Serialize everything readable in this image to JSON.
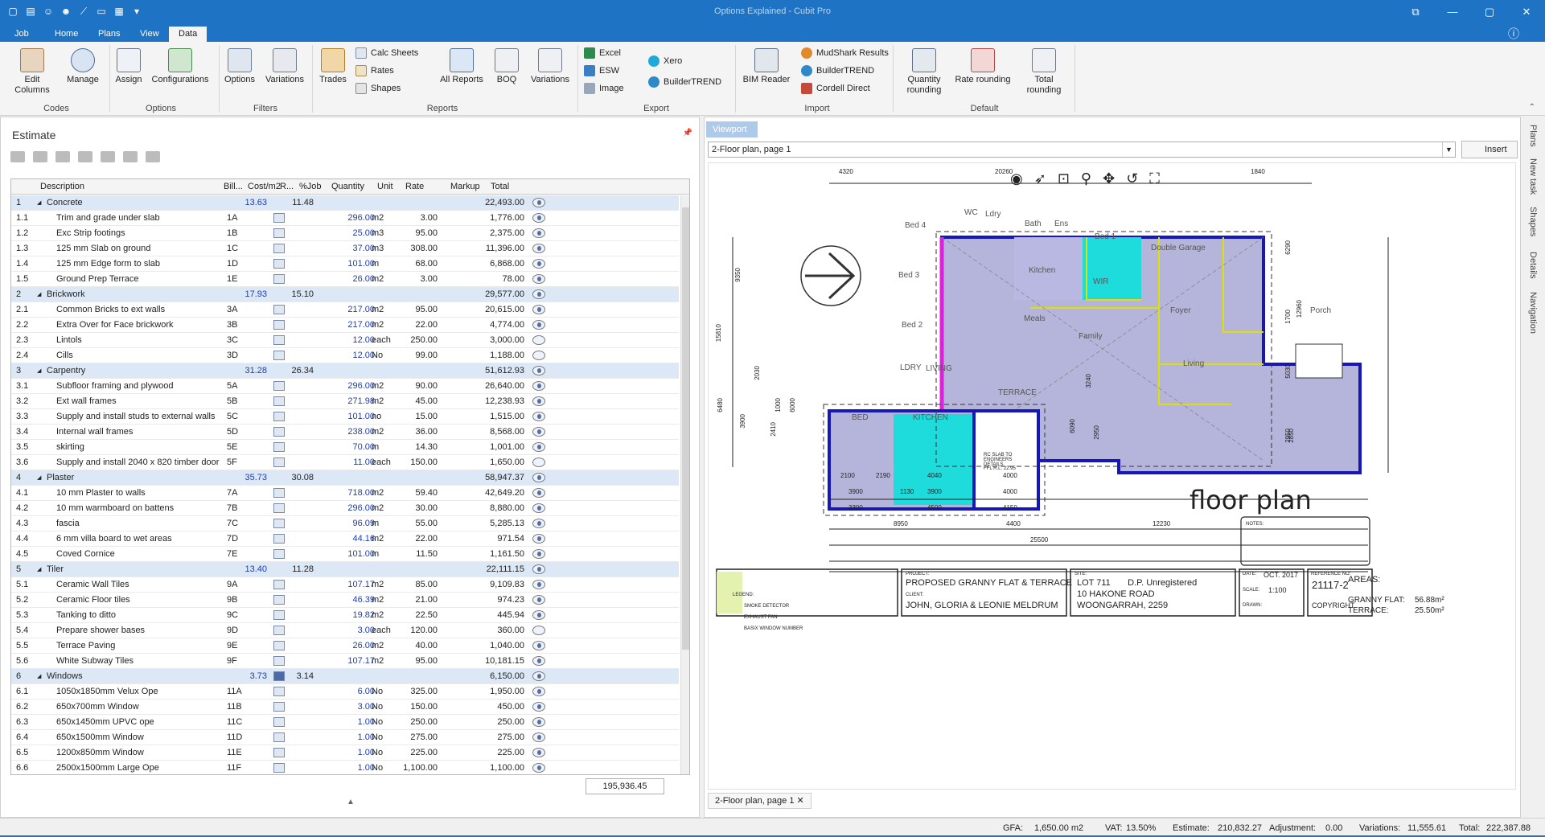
{
  "window": {
    "title": "Options Explained - Cubit Pro"
  },
  "menu": {
    "tabs": [
      "Job",
      "Home",
      "Plans",
      "View",
      "Data"
    ],
    "active": "Data"
  },
  "ribbon": {
    "codes": {
      "label": "Codes",
      "edit_columns": "Edit Columns",
      "manage": "Manage"
    },
    "options": {
      "label": "Options",
      "assign": "Assign",
      "configurations": "Configurations"
    },
    "filters": {
      "label": "Filters",
      "options": "Options",
      "variations": "Variations"
    },
    "reports": {
      "label": "Reports",
      "trades": "Trades",
      "calc_sheets": "Calc Sheets",
      "rates": "Rates",
      "shapes": "Shapes",
      "all_reports": "All Reports",
      "boq": "BOQ",
      "variations": "Variations"
    },
    "export": {
      "label": "Export",
      "excel": "Excel",
      "esw": "ESW",
      "image": "Image",
      "xero": "Xero",
      "buildertrend": "BuilderTREND"
    },
    "import": {
      "label": "Import",
      "bim_reader": "BIM Reader",
      "mudshark": "MudShark Results",
      "buildertrend": "BuilderTREND",
      "cordell": "Cordell Direct"
    },
    "default": {
      "label": "Default",
      "quantity_rounding": "Quantity rounding",
      "rate_rounding": "Rate rounding",
      "total_rounding": "Total rounding"
    }
  },
  "estimate": {
    "title": "Estimate",
    "columns": [
      "Description",
      "Bill...",
      "Cost/m2",
      "R...",
      "%Job",
      "Quantity",
      "Unit",
      "Rate",
      "Markup",
      "Total"
    ],
    "rows": [
      {
        "id": "1",
        "desc": "Concrete",
        "group": true,
        "cost": "13.63",
        "job": "11.48",
        "total": "22,493.00",
        "eye": true
      },
      {
        "id": "1.1",
        "desc": "Trim and grade under slab",
        "bill": "1A",
        "qty": "296.00",
        "unit": "m2",
        "rate": "3.00",
        "total": "1,776.00",
        "eye": true
      },
      {
        "id": "1.2",
        "desc": "Exc Strip footings",
        "bill": "1B",
        "qty": "25.00",
        "unit": "m3",
        "rate": "95.00",
        "total": "2,375.00",
        "eye": true
      },
      {
        "id": "1.3",
        "desc": "125 mm Slab on ground",
        "bill": "1C",
        "qty": "37.00",
        "unit": "m3",
        "rate": "308.00",
        "total": "11,396.00",
        "eye": true
      },
      {
        "id": "1.4",
        "desc": "125 mm Edge form to slab",
        "bill": "1D",
        "qty": "101.00",
        "unit": "m",
        "rate": "68.00",
        "total": "6,868.00",
        "eye": true
      },
      {
        "id": "1.5",
        "desc": "Ground Prep Terrace",
        "bill": "1E",
        "qty": "26.00",
        "unit": "m2",
        "rate": "3.00",
        "total": "78.00",
        "eye": true
      },
      {
        "id": "2",
        "desc": "Brickwork",
        "group": true,
        "cost": "17.93",
        "job": "15.10",
        "total": "29,577.00",
        "eye": true
      },
      {
        "id": "2.1",
        "desc": "Common Bricks to ext walls",
        "bill": "3A",
        "qty": "217.00",
        "unit": "m2",
        "rate": "95.00",
        "total": "20,615.00",
        "eye": true
      },
      {
        "id": "2.2",
        "desc": "Extra Over for Face brickwork",
        "bill": "3B",
        "qty": "217.00",
        "unit": "m2",
        "rate": "22.00",
        "total": "4,774.00",
        "eye": true
      },
      {
        "id": "2.3",
        "desc": "Lintols",
        "bill": "3C",
        "qty": "12.00",
        "unit": "each",
        "rate": "250.00",
        "total": "3,000.00",
        "eye": false
      },
      {
        "id": "2.4",
        "desc": "Cills",
        "bill": "3D",
        "qty": "12.00",
        "unit": "No",
        "rate": "99.00",
        "total": "1,188.00",
        "eye": false
      },
      {
        "id": "3",
        "desc": "Carpentry",
        "group": true,
        "cost": "31.28",
        "job": "26.34",
        "total": "51,612.93",
        "eye": true
      },
      {
        "id": "3.1",
        "desc": "Subfloor framing and plywood",
        "bill": "5A",
        "qty": "296.00",
        "unit": "m2",
        "rate": "90.00",
        "total": "26,640.00",
        "eye": true
      },
      {
        "id": "3.2",
        "desc": "Ext wall frames",
        "bill": "5B",
        "qty": "271.98",
        "unit": "m2",
        "rate": "45.00",
        "total": "12,238.93",
        "eye": true
      },
      {
        "id": "3.3",
        "desc": "Supply and install studs to external walls",
        "bill": "5C",
        "qty": "101.00",
        "unit": "no",
        "rate": "15.00",
        "total": "1,515.00",
        "eye": true
      },
      {
        "id": "3.4",
        "desc": "Internal wall frames",
        "bill": "5D",
        "qty": "238.00",
        "unit": "m2",
        "rate": "36.00",
        "total": "8,568.00",
        "eye": true
      },
      {
        "id": "3.5",
        "desc": "skirting",
        "bill": "5E",
        "qty": "70.00",
        "unit": "m",
        "rate": "14.30",
        "total": "1,001.00",
        "eye": true
      },
      {
        "id": "3.6",
        "desc": "Supply and install 2040 x 820 timber door",
        "bill": "5F",
        "qty": "11.00",
        "unit": "each",
        "rate": "150.00",
        "total": "1,650.00",
        "eye": false
      },
      {
        "id": "4",
        "desc": "Plaster",
        "group": true,
        "cost": "35.73",
        "job": "30.08",
        "total": "58,947.37",
        "eye": true
      },
      {
        "id": "4.1",
        "desc": "10 mm Plaster to walls",
        "bill": "7A",
        "qty": "718.00",
        "unit": "m2",
        "rate": "59.40",
        "total": "42,649.20",
        "eye": true
      },
      {
        "id": "4.2",
        "desc": "10 mm warmboard on battens",
        "bill": "7B",
        "qty": "296.00",
        "unit": "m2",
        "rate": "30.00",
        "total": "8,880.00",
        "eye": true
      },
      {
        "id": "4.3",
        "desc": "fascia",
        "bill": "7C",
        "qty": "96.09",
        "unit": "m",
        "rate": "55.00",
        "total": "5,285.13",
        "eye": true
      },
      {
        "id": "4.4",
        "desc": "6 mm villa board to wet areas",
        "bill": "7D",
        "qty": "44.16",
        "unit": "m2",
        "rate": "22.00",
        "total": "971.54",
        "eye": true
      },
      {
        "id": "4.5",
        "desc": "Coved Cornice",
        "bill": "7E",
        "qty": "101.00",
        "unit": "m",
        "rate": "11.50",
        "total": "1,161.50",
        "eye": true
      },
      {
        "id": "5",
        "desc": "Tiler",
        "group": true,
        "cost": "13.40",
        "job": "11.28",
        "total": "22,111.15",
        "eye": true
      },
      {
        "id": "5.1",
        "desc": "Ceramic Wall Tiles",
        "bill": "9A",
        "qty": "107.17",
        "unit": "m2",
        "rate": "85.00",
        "total": "9,109.83",
        "eye": true
      },
      {
        "id": "5.2",
        "desc": "Ceramic Floor tiles",
        "bill": "9B",
        "qty": "46.39",
        "unit": "m2",
        "rate": "21.00",
        "total": "974.23",
        "eye": true
      },
      {
        "id": "5.3",
        "desc": "Tanking to ditto",
        "bill": "9C",
        "qty": "19.82",
        "unit": "m2",
        "rate": "22.50",
        "total": "445.94",
        "eye": true
      },
      {
        "id": "5.4",
        "desc": "Prepare shower bases",
        "bill": "9D",
        "qty": "3.00",
        "unit": "each",
        "rate": "120.00",
        "total": "360.00",
        "eye": false
      },
      {
        "id": "5.5",
        "desc": "Terrace Paving",
        "bill": "9E",
        "qty": "26.00",
        "unit": "m2",
        "rate": "40.00",
        "total": "1,040.00",
        "eye": true
      },
      {
        "id": "5.6",
        "desc": "White Subway Tiles",
        "bill": "9F",
        "qty": "107.17",
        "unit": "m2",
        "rate": "95.00",
        "total": "10,181.15",
        "eye": true
      },
      {
        "id": "6",
        "desc": "Windows",
        "group": true,
        "cost": "3.73",
        "job": "3.14",
        "total": "6,150.00",
        "eye": true
      },
      {
        "id": "6.1",
        "desc": "1050x1850mm Velux Ope",
        "bill": "11A",
        "qty": "6.00",
        "unit": "No",
        "rate": "325.00",
        "total": "1,950.00",
        "eye": true
      },
      {
        "id": "6.2",
        "desc": "650x700mm Window",
        "bill": "11B",
        "qty": "3.00",
        "unit": "No",
        "rate": "150.00",
        "total": "450.00",
        "eye": true
      },
      {
        "id": "6.3",
        "desc": "650x1450mm UPVC ope",
        "bill": "11C",
        "qty": "1.00",
        "unit": "No",
        "rate": "250.00",
        "total": "250.00",
        "eye": true
      },
      {
        "id": "6.4",
        "desc": "650x1500mm Window",
        "bill": "11D",
        "qty": "1.00",
        "unit": "No",
        "rate": "275.00",
        "total": "275.00",
        "eye": true
      },
      {
        "id": "6.5",
        "desc": "1200x850mm Window",
        "bill": "11E",
        "qty": "1.00",
        "unit": "No",
        "rate": "225.00",
        "total": "225.00",
        "eye": true
      },
      {
        "id": "6.6",
        "desc": "2500x1500mm Large Ope",
        "bill": "11F",
        "qty": "1.00",
        "unit": "No",
        "rate": "1,100.00",
        "total": "1,100.00",
        "eye": true
      }
    ],
    "grand_total": "195,936.45"
  },
  "viewport": {
    "tab": "Viewport",
    "document": "2-Floor plan, page 1",
    "insert": "Insert",
    "bottom_tab": "2-Floor plan, page 1",
    "plan": {
      "title": "floor plan",
      "areas_heading": "AREAS:",
      "granny_flat": "GRANNY FLAT:",
      "granny_flat_val": "56.88m²",
      "terrace": "TERRACE:",
      "terrace_val": "25.50m²",
      "project_label": "PROJECT:",
      "project": "PROPOSED GRANNY FLAT & TERRACE",
      "client_label": "CLIENT:",
      "client": "JOHN, GLORIA & LEONIE MELDRUM",
      "site_label": "SITE:",
      "site_line1": "LOT 711       D.P. Unregistered",
      "site_line2": "10 HAKONE ROAD",
      "site_line3": "WOONGARRAH,  2259",
      "date_label": "DATE:",
      "date": "OCT. 2017",
      "ref_label": "REFERENCE NO:",
      "ref": "21117-2",
      "scale_label": "SCALE:",
      "scale": "1:100",
      "drawn_label": "DRAWN:",
      "copyright": "COPYRIGHT",
      "legend": "LEGEND:",
      "legend1": "SMOKE DETECTOR",
      "legend2": "EXHAUST FAN",
      "legend3": "BASIX WINDOW NUMBER",
      "notes": "NOTES:",
      "rooms": [
        "Bed 4",
        "Ldry",
        "Bath",
        "Ens",
        "Bed 1",
        "Double Garage",
        "Bed 3",
        "Kitchen",
        "WIR",
        "Bed 2",
        "Meals",
        "Family",
        "Foyer",
        "Porch",
        "Living",
        "BED",
        "LIVING",
        "KITCHEN",
        "TERRACE",
        "WC",
        "LDRY"
      ],
      "dims_top": [
        "4320",
        "20260",
        "1840"
      ],
      "dims_bottom": [
        "2100",
        "2190",
        "4040",
        "4000",
        "3900",
        "1130",
        "3900",
        "4000",
        "3300",
        "4500",
        "4150",
        "8950",
        "4400",
        "12230",
        "25500"
      ],
      "dims_side": [
        "9350",
        "15810",
        "6290",
        "12960",
        "1700",
        "5030",
        "2950",
        "2850",
        "6480",
        "6000",
        "3900",
        "2410",
        "2030",
        "1000",
        "3240",
        "6090",
        "2950"
      ],
      "terrace_note": "RC SLAB TO ENGINEERS DETAILS",
      "ffl": "FFL R.L. 22.95"
    }
  },
  "side_tabs": [
    "Plans",
    "New task",
    "Shapes",
    "Details",
    "Navigation"
  ],
  "status": {
    "gfa_label": "GFA:",
    "gfa": "1,650.00 m2",
    "vat_label": "VAT:",
    "vat": "13.50%",
    "est_label": "Estimate:",
    "est": "210,832.27",
    "adj_label": "Adjustment:",
    "adj": "0.00",
    "var_label": "Variations:",
    "var": "11,555.61",
    "tot_label": "Total:",
    "tot": "222,387.88"
  }
}
